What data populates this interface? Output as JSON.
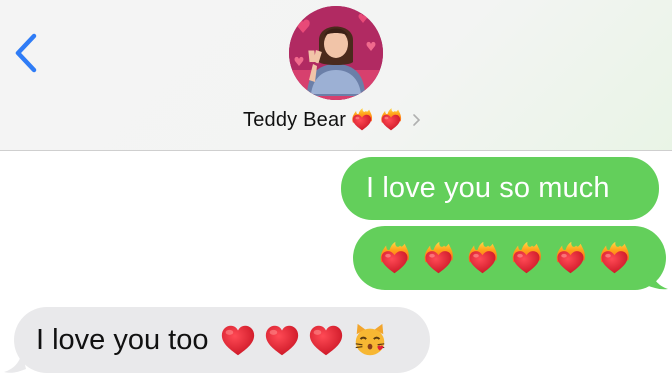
{
  "header": {
    "contact_name": "Teddy Bear",
    "name_emojis": [
      "heart-on-fire-icon",
      "heart-on-fire-icon"
    ]
  },
  "colors": {
    "sent_bubble": "#63cf5b",
    "received_bubble": "#e9e9eb",
    "accent_blue": "#2f7cf6"
  },
  "messages": [
    {
      "direction": "sent",
      "text": "I love you so much"
    },
    {
      "direction": "sent",
      "emojis": [
        "heart-on-fire-icon",
        "heart-on-fire-icon",
        "heart-on-fire-icon",
        "heart-on-fire-icon",
        "heart-on-fire-icon",
        "heart-on-fire-icon"
      ]
    },
    {
      "direction": "received",
      "text": "I love you too",
      "emojis": [
        "red-heart-icon",
        "red-heart-icon",
        "red-heart-icon",
        "kissing-cat-icon"
      ]
    }
  ]
}
